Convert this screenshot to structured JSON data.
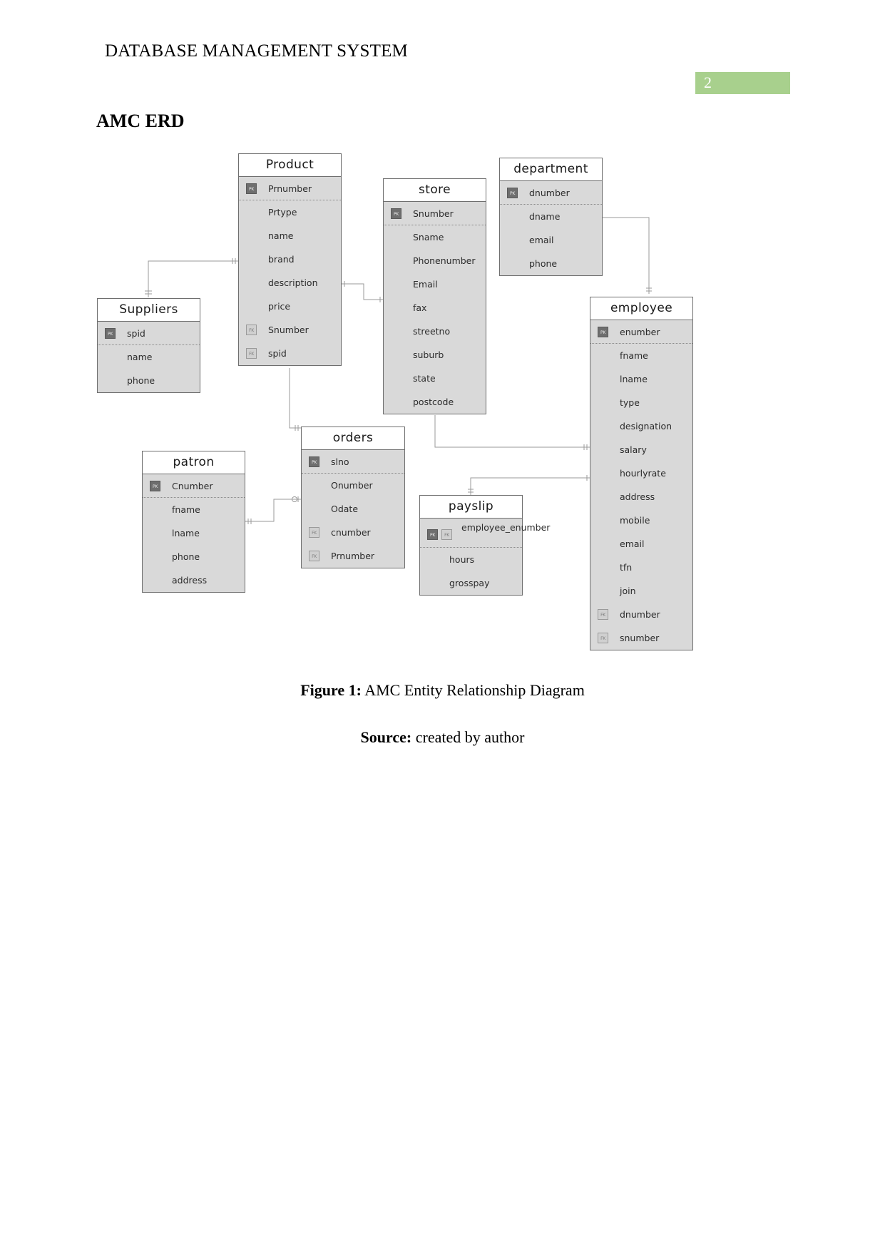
{
  "header": {
    "title": "DATABASE MANAGEMENT SYSTEM",
    "page_number": "2",
    "page_number_bg": "#a8d08d"
  },
  "section": {
    "heading": "AMC ERD"
  },
  "captions": {
    "figure_label": "Figure 1:",
    "figure_text": " AMC Entity Relationship Diagram",
    "source_label": "Source:",
    "source_text": " created by author"
  },
  "diagram": {
    "type": "erd",
    "entities": [
      {
        "id": "product",
        "title": "Product",
        "attributes": [
          {
            "name": "Prnumber",
            "key": "PK"
          },
          {
            "name": "Prtype",
            "key": ""
          },
          {
            "name": "name",
            "key": ""
          },
          {
            "name": "brand",
            "key": ""
          },
          {
            "name": "description",
            "key": ""
          },
          {
            "name": "price",
            "key": ""
          },
          {
            "name": "Snumber",
            "key": "FK"
          },
          {
            "name": "spid",
            "key": "FK"
          }
        ]
      },
      {
        "id": "store",
        "title": "store",
        "attributes": [
          {
            "name": "Snumber",
            "key": "PK"
          },
          {
            "name": "Sname",
            "key": ""
          },
          {
            "name": "Phonenumber",
            "key": ""
          },
          {
            "name": "Email",
            "key": ""
          },
          {
            "name": "fax",
            "key": ""
          },
          {
            "name": "streetno",
            "key": ""
          },
          {
            "name": "suburb",
            "key": ""
          },
          {
            "name": "state",
            "key": ""
          },
          {
            "name": "postcode",
            "key": ""
          }
        ]
      },
      {
        "id": "department",
        "title": "department",
        "attributes": [
          {
            "name": "dnumber",
            "key": "PK"
          },
          {
            "name": "dname",
            "key": ""
          },
          {
            "name": "email",
            "key": ""
          },
          {
            "name": "phone",
            "key": ""
          }
        ]
      },
      {
        "id": "suppliers",
        "title": "Suppliers",
        "attributes": [
          {
            "name": "spid",
            "key": "PK"
          },
          {
            "name": "name",
            "key": ""
          },
          {
            "name": "phone",
            "key": ""
          }
        ]
      },
      {
        "id": "employee",
        "title": "employee",
        "attributes": [
          {
            "name": "enumber",
            "key": "PK"
          },
          {
            "name": "fname",
            "key": ""
          },
          {
            "name": "lname",
            "key": ""
          },
          {
            "name": "type",
            "key": ""
          },
          {
            "name": "designation",
            "key": ""
          },
          {
            "name": "salary",
            "key": ""
          },
          {
            "name": "hourlyrate",
            "key": ""
          },
          {
            "name": "address",
            "key": ""
          },
          {
            "name": "mobile",
            "key": ""
          },
          {
            "name": "email",
            "key": ""
          },
          {
            "name": "tfn",
            "key": ""
          },
          {
            "name": "join",
            "key": ""
          },
          {
            "name": "dnumber",
            "key": "FK"
          },
          {
            "name": "snumber",
            "key": "FK"
          }
        ]
      },
      {
        "id": "orders",
        "title": "orders",
        "attributes": [
          {
            "name": "slno",
            "key": "PK"
          },
          {
            "name": "Onumber",
            "key": ""
          },
          {
            "name": "Odate",
            "key": ""
          },
          {
            "name": "cnumber",
            "key": "FK"
          },
          {
            "name": "Prnumber",
            "key": "FK"
          }
        ]
      },
      {
        "id": "patron",
        "title": "patron",
        "attributes": [
          {
            "name": "Cnumber",
            "key": "PK"
          },
          {
            "name": "fname",
            "key": ""
          },
          {
            "name": "lname",
            "key": ""
          },
          {
            "name": "phone",
            "key": ""
          },
          {
            "name": "address",
            "key": ""
          }
        ]
      },
      {
        "id": "payslip",
        "title": "payslip",
        "attributes": [
          {
            "name": "employee_enumber",
            "key": "PKFK"
          },
          {
            "name": "hours",
            "key": ""
          },
          {
            "name": "grosspay",
            "key": ""
          }
        ]
      }
    ],
    "relationships": [
      {
        "from": "suppliers",
        "to": "product"
      },
      {
        "from": "product",
        "to": "store"
      },
      {
        "from": "department",
        "to": "employee"
      },
      {
        "from": "store",
        "to": "employee"
      },
      {
        "from": "product",
        "to": "orders"
      },
      {
        "from": "patron",
        "to": "orders"
      },
      {
        "from": "employee",
        "to": "payslip"
      }
    ]
  },
  "colors": {
    "entity_fill": "#d9d9d9",
    "entity_border": "#6e6e6e",
    "header_fill": "#ffffff",
    "pk_badge": "#6e6e6e",
    "fk_badge": "#d0d0d0",
    "connector": "#9a9a9a"
  }
}
